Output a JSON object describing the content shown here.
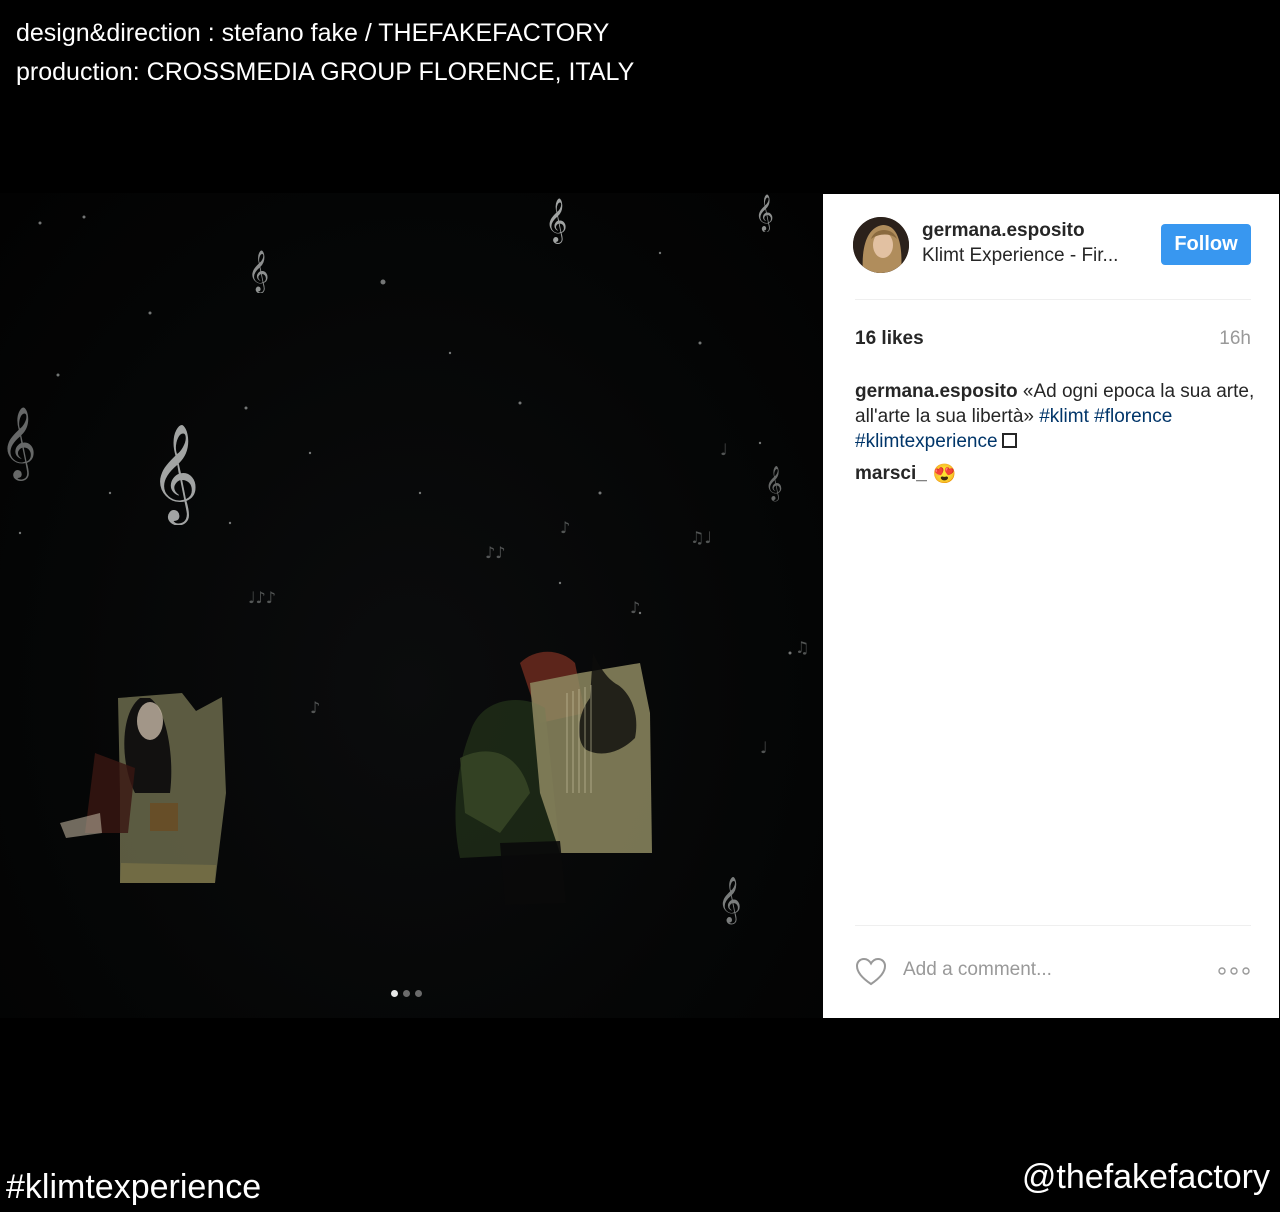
{
  "credits": {
    "line1": "design&direction : stefano fake / THEFAKEFACTORY",
    "line2": "production: CROSSMEDIA GROUP FLORENCE, ITALY"
  },
  "post": {
    "username": "germana.esposito",
    "location": "Klimt Experience - Fir...",
    "follow_label": "Follow",
    "likes": "16 likes",
    "time": "16h",
    "caption_user": "germana.esposito",
    "caption_text": "«Ad ogni epoca la sua arte, all'arte la sua libertà»",
    "hashtags": [
      "#klimt",
      "#florence",
      "#klimtexperience"
    ],
    "comment_user": "marsci_",
    "comment_emoji": "😍",
    "comment_placeholder": "Add a comment...",
    "carousel_count": 3,
    "carousel_active": 1
  },
  "overlay": {
    "hashtag": "#klimtexperience",
    "handle": "@thefakefactory"
  },
  "colors": {
    "follow_bg": "#3897f0",
    "hashtag_link": "#003569",
    "page_bg": "#000000"
  }
}
